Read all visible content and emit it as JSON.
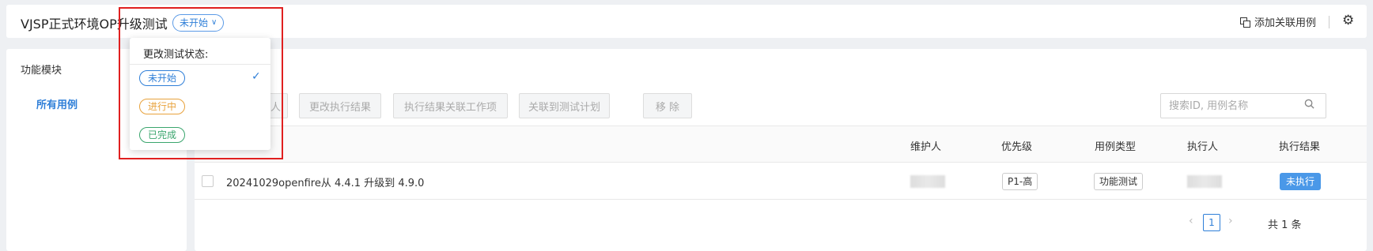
{
  "header": {
    "title": "VJSP正式环境OP升级测试",
    "status": "未开始",
    "add_case": "添加关联用例"
  },
  "sidebar": {
    "title": "功能模块",
    "items": [
      {
        "label": "所有用例"
      }
    ]
  },
  "toolbar": {
    "buttons": [
      {
        "label": "人"
      },
      {
        "label": "更改执行结果"
      },
      {
        "label": "执行结果关联工作项"
      },
      {
        "label": "关联到测试计划"
      },
      {
        "label": "移 除"
      }
    ],
    "search_placeholder": "搜索ID, 用例名称"
  },
  "table": {
    "columns": [
      "维护人",
      "优先级",
      "用例类型",
      "执行人",
      "执行结果"
    ],
    "rows": [
      {
        "name": "20241029openfire从 4.4.1 升级到 4.9.0",
        "priority": "P1-高",
        "type": "功能测试",
        "result": "未执行"
      }
    ]
  },
  "pagination": {
    "total": "共 1 条",
    "current": "1"
  },
  "status_menu": {
    "title": "更改测试状态:",
    "options": [
      {
        "label": "未开始",
        "color": "#2f7fd8",
        "selected": true
      },
      {
        "label": "进行中",
        "color": "#e8a23c",
        "selected": false
      },
      {
        "label": "已完成",
        "color": "#3aa56d",
        "selected": false
      }
    ]
  },
  "colors": {
    "accent": "#2f7fd8",
    "highlight": "#e02020"
  }
}
